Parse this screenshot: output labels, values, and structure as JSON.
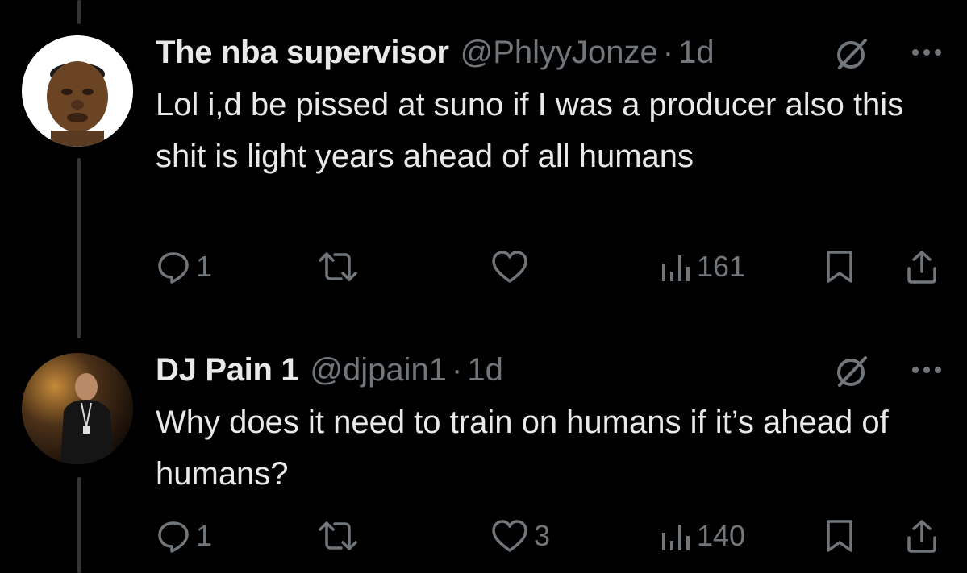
{
  "tweets": [
    {
      "name": "The nba supervisor",
      "handle": "@PhlyyJonze",
      "separator": "·",
      "time": "1d",
      "text": "Lol i,d be pissed at suno if I was a producer also this shit is light years ahead of all humans",
      "replies": "1",
      "likes": "",
      "views": "161"
    },
    {
      "name": "DJ Pain 1",
      "handle": "@djpain1",
      "separator": "·",
      "time": "1d",
      "text": "Why does it need to train on humans if it’s ahead of humans?",
      "replies": "1",
      "likes": "3",
      "views": "140"
    }
  ],
  "icons": [
    "reply-icon",
    "retweet-icon",
    "like-icon",
    "views-icon",
    "bookmark-icon",
    "share-icon",
    "grok-icon",
    "more-icon"
  ],
  "colors": {
    "background": "#000000",
    "text": "#e7e9ea",
    "muted": "#71767b",
    "thread_line": "#333639"
  }
}
